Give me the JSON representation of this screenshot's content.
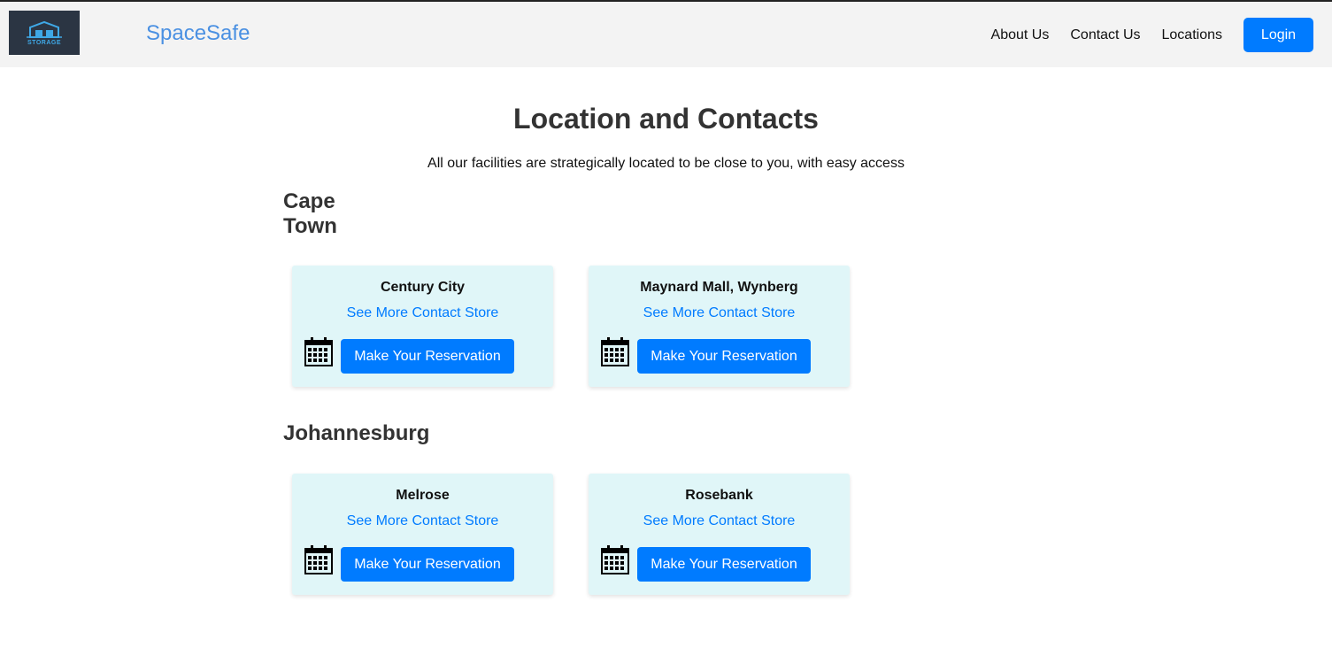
{
  "header": {
    "logo_text": "STORAGE",
    "brand": "SpaceSafe",
    "nav": [
      "About Us",
      "Contact Us",
      "Locations"
    ],
    "login_label": "Login"
  },
  "main": {
    "title": "Location and Contacts",
    "subtitle": "All our facilities are strategically located to be close to you, with easy access"
  },
  "regions": [
    {
      "name_line1": "Cape",
      "name_line2": "Town",
      "stores": [
        {
          "name": "Century City",
          "link": "See More Contact Store",
          "button": "Make Your Reservation"
        },
        {
          "name": "Maynard Mall, Wynberg",
          "link": "See More Contact Store",
          "button": "Make Your Reservation"
        }
      ]
    },
    {
      "name": "Johannesburg",
      "stores": [
        {
          "name": "Melrose",
          "link": "See More Contact Store",
          "button": "Make Your Reservation"
        },
        {
          "name": "Rosebank",
          "link": "See More Contact Store",
          "button": "Make Your Reservation"
        }
      ]
    }
  ],
  "icons": {
    "calendar": "calendar-icon",
    "logo": "warehouse-logo"
  },
  "colors": {
    "accent": "#007bff",
    "brand": "#4a90e2",
    "card_bg": "#e0f6f8",
    "navbar_bg": "#f3f3f3"
  }
}
